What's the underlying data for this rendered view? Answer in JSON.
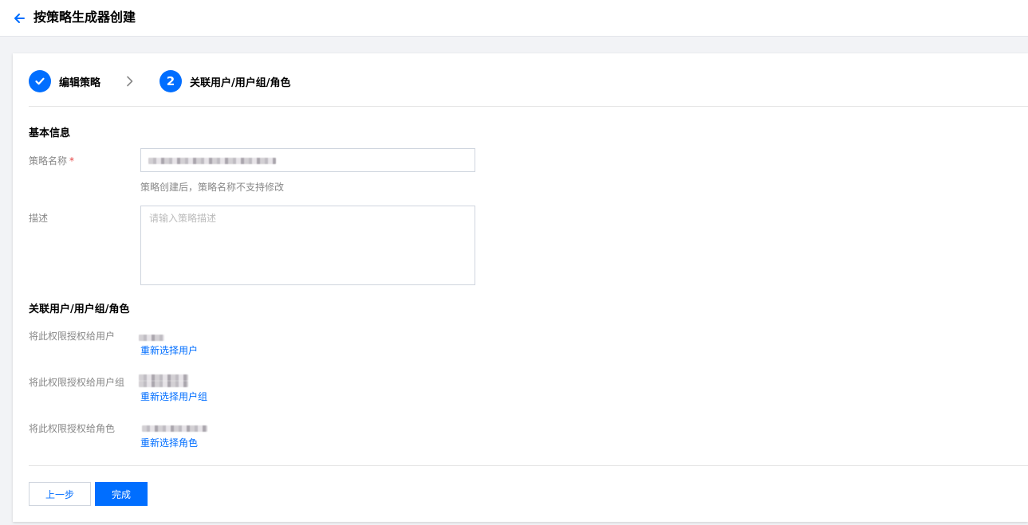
{
  "header": {
    "title": "按策略生成器创建",
    "back_icon": "arrow-left-icon"
  },
  "steps": [
    {
      "label": "编辑策略",
      "state": "done",
      "icon": "check-icon"
    },
    {
      "number": "2",
      "label": "关联用户/用户组/角色",
      "state": "active"
    }
  ],
  "basic_info": {
    "title": "基本信息",
    "policy_name_label": "策略名称",
    "required_mark": "*",
    "policy_name_help": "策略创建后，策略名称不支持修改",
    "description_label": "描述",
    "description_placeholder": "请输入策略描述"
  },
  "association": {
    "title": "关联用户/用户组/角色",
    "user_label": "将此权限授权给用户",
    "user_link": "重新选择用户",
    "group_label": "将此权限授权给用户组",
    "group_link": "重新选择用户组",
    "role_label": "将此权限授权给角色",
    "role_link": "重新选择角色"
  },
  "footer": {
    "prev_label": "上一步",
    "finish_label": "完成"
  },
  "colors": {
    "accent": "#006eff",
    "required": "#e54545",
    "page_bg": "#f2f3f6"
  }
}
